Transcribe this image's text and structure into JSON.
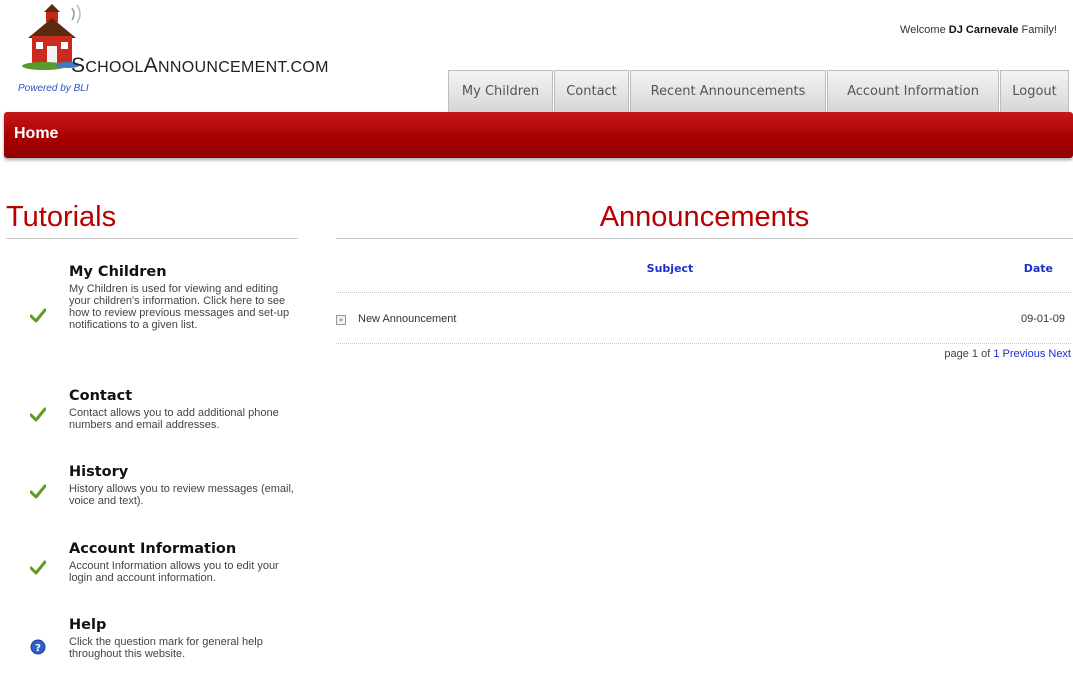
{
  "header": {
    "logo_prefix": "S",
    "logo_first": "CHOOL",
    "logo_a": "A",
    "logo_rest": "NNOUNCEMENT.COM",
    "powered_by": "Powered by BLI",
    "welcome_prefix": "Welcome",
    "welcome_name": "DJ Carnevale",
    "welcome_suffix": "Family!"
  },
  "nav": {
    "tabs": [
      {
        "label": "My Children"
      },
      {
        "label": "Contact"
      },
      {
        "label": "Recent Announcements"
      },
      {
        "label": "Account Information"
      },
      {
        "label": "Logout"
      }
    ]
  },
  "page": {
    "title": "Home"
  },
  "tutorials": {
    "heading": "Tutorials",
    "items": [
      {
        "title": "My Children",
        "icon": "checkmark-icon",
        "description": "My Children is used for viewing and editing your children's information. Click here to see how to review previous messages and set-up notifications to a given list."
      },
      {
        "title": "Contact",
        "icon": "checkmark-icon",
        "description": "Contact allows you to add additional phone numbers and email addresses."
      },
      {
        "title": "History",
        "icon": "checkmark-icon",
        "description": "History allows you to review messages (email, voice and text)."
      },
      {
        "title": "Account Information",
        "icon": "checkmark-icon",
        "description": "Account Information allows you to edit your login and account information."
      },
      {
        "title": "Help",
        "icon": "help-icon",
        "description": "Click the question mark for general help throughout this website."
      }
    ]
  },
  "announcements": {
    "heading": "Announcements",
    "columns": {
      "subject": "Subject",
      "date": "Date"
    },
    "rows": [
      {
        "subject": "New Announcement",
        "date": "09-01-09"
      }
    ],
    "pager": {
      "prefix": "page",
      "current": "1",
      "of": "of",
      "total": "1",
      "previous": "Previous",
      "next": "Next"
    }
  },
  "colors": {
    "brand_red": "#a80000",
    "link_blue": "#1b2fd0",
    "check_green": "#5c9e1e"
  }
}
